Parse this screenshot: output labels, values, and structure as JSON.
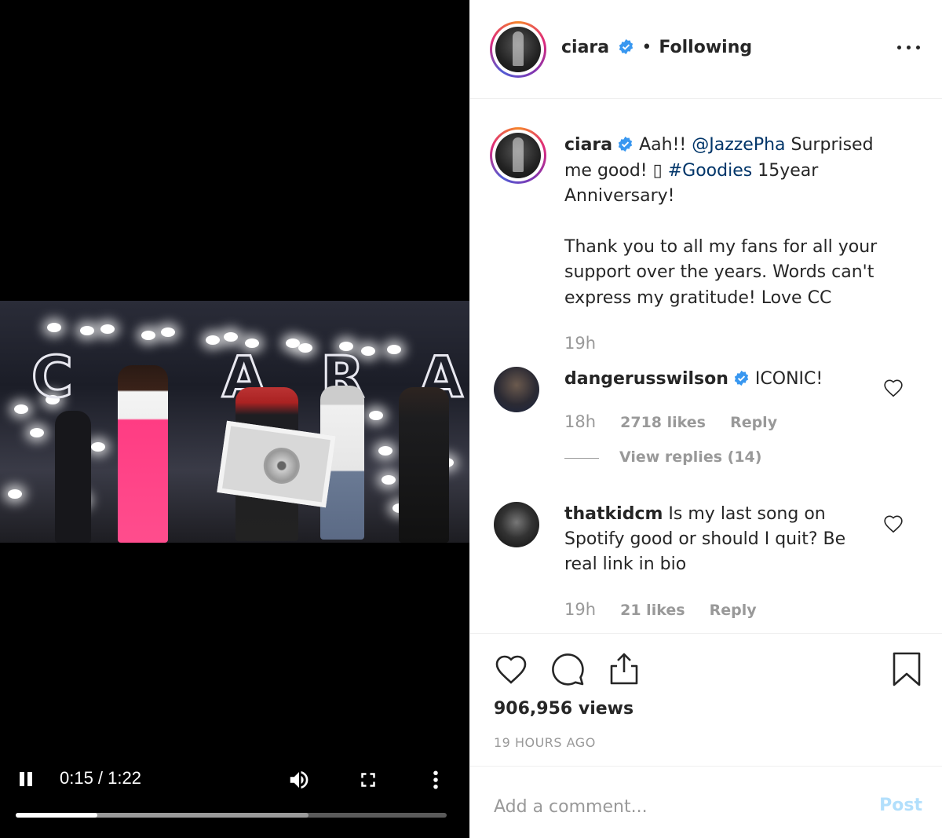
{
  "video": {
    "time_display": "0:15 / 1:22",
    "elapsed": "0:15",
    "duration": "1:22",
    "progress_fraction": 0.19,
    "buffered_fraction": 0.68
  },
  "header": {
    "username": "ciara",
    "separator": "•",
    "follow_status": "Following"
  },
  "caption": {
    "username": "ciara",
    "text_before": " Aah!! ",
    "mention": "@JazzePha",
    "text_mid": " Surprised me good! ▯ ",
    "hashtag": "#Goodies",
    "text_after": " 15year Anniversary!",
    "paragraph2": "Thank you to all my fans for all your support over the years. Words can't express my gratitude! Love CC",
    "time": "19h"
  },
  "comments": [
    {
      "username": "dangerusswilson",
      "text": "ICONIC!",
      "time": "18h",
      "likes": "2718 likes",
      "reply": "Reply",
      "view_replies": "View replies (14)"
    },
    {
      "username": "thatkidcm",
      "text": " Is my last song on Spotify good or should I quit? Be real link in bio",
      "time": "19h",
      "likes": "21 likes",
      "reply": "Reply"
    }
  ],
  "post": {
    "views": "906,956 views",
    "age": "19 HOURS AGO"
  },
  "add_comment": {
    "placeholder": "Add a comment...",
    "post_label": "Post"
  },
  "colors": {
    "verified": "#3897f0",
    "link": "#003569",
    "muted": "#999999",
    "post_disabled": "#b2dffc"
  },
  "icons": [
    "pause-icon",
    "volume-icon",
    "fullscreen-icon",
    "kebab-icon",
    "verified-icon",
    "more-icon",
    "heart-icon",
    "comment-icon",
    "share-icon",
    "bookmark-icon"
  ]
}
